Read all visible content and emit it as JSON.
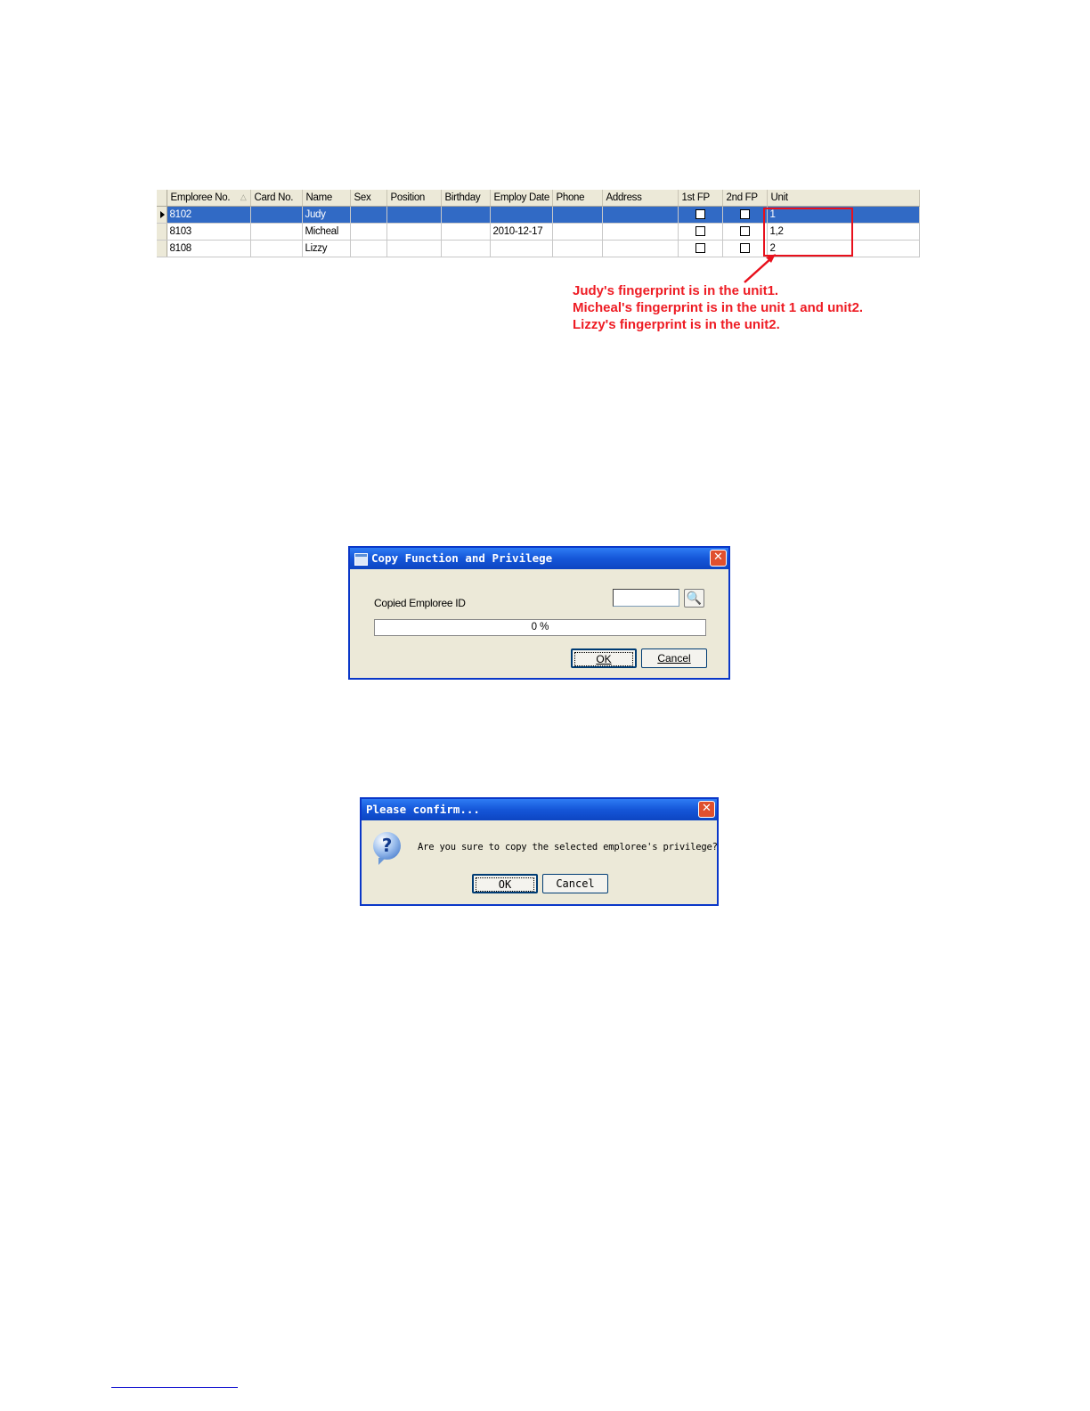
{
  "grid": {
    "columns": [
      "Emploree No.",
      "Card No.",
      "Name",
      "Sex",
      "Position",
      "Birthday",
      "Employ Date",
      "Phone",
      "Address",
      "1st FP",
      "2nd FP",
      "Unit"
    ],
    "sort_indicator": "△",
    "rows": [
      {
        "emp_no": "8102",
        "card_no": "",
        "name": "Judy",
        "sex": "",
        "position": "",
        "birthday": "",
        "employ_date": "",
        "phone": "",
        "address": "",
        "fp1": false,
        "fp2": false,
        "unit": "1",
        "selected": true
      },
      {
        "emp_no": "8103",
        "card_no": "",
        "name": "Micheal",
        "sex": "",
        "position": "",
        "birthday": "",
        "employ_date": "2010-12-17",
        "phone": "",
        "address": "",
        "fp1": false,
        "fp2": false,
        "unit": "1,2",
        "selected": false
      },
      {
        "emp_no": "8108",
        "card_no": "",
        "name": "Lizzy",
        "sex": "",
        "position": "",
        "birthday": "",
        "employ_date": "",
        "phone": "",
        "address": "",
        "fp1": false,
        "fp2": false,
        "unit": "2",
        "selected": false
      }
    ],
    "colors": {
      "selection": "#316ac5",
      "header": "#ece9d8"
    }
  },
  "annotation": {
    "lines": [
      "Judy's fingerprint is in the unit1.",
      "Micheal's fingerprint is in the unit 1 and unit2.",
      "Lizzy's fingerprint is in the unit2."
    ],
    "color": "#ee1c24"
  },
  "copy_dialog": {
    "title": "Copy Function and Privilege",
    "close_label": "✕",
    "field_label": "Copied Emploree ID",
    "field_value": "",
    "lookup_icon": "search-document-icon",
    "progress_percent": 0,
    "progress_text": "0 %",
    "ok_label": "OK",
    "cancel_label": "Cancel"
  },
  "confirm_dialog": {
    "title": "Please confirm...",
    "close_label": "✕",
    "icon": "question-icon",
    "message": "Are you sure to copy the selected emploree's privilege?",
    "ok_label": "OK",
    "cancel_label": "Cancel"
  }
}
